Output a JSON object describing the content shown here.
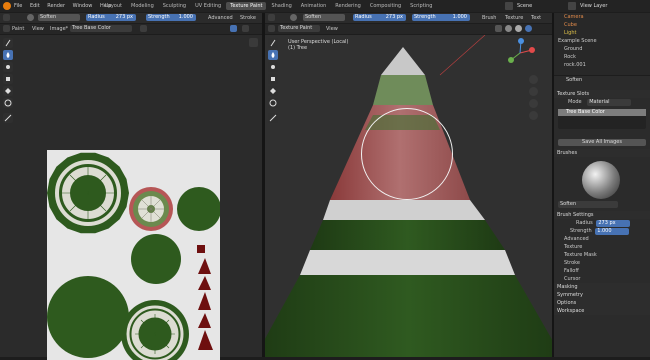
{
  "menu": [
    "File",
    "Edit",
    "Render",
    "Window",
    "Help"
  ],
  "workspaces": [
    {
      "label": "Layout",
      "active": false
    },
    {
      "label": "Modeling",
      "active": false
    },
    {
      "label": "Sculpting",
      "active": false
    },
    {
      "label": "UV Editing",
      "active": false
    },
    {
      "label": "Texture Paint",
      "active": true
    },
    {
      "label": "Shading",
      "active": false
    },
    {
      "label": "Animation",
      "active": false
    },
    {
      "label": "Rendering",
      "active": false
    },
    {
      "label": "Compositing",
      "active": false
    },
    {
      "label": "Scripting",
      "active": false
    }
  ],
  "scene": {
    "name": "Scene",
    "view_layer": "View Layer"
  },
  "image_editor": {
    "brush": "Soften",
    "radius_label": "Radius",
    "radius_value": "273 px",
    "strength_label": "Strength",
    "strength_value": "1.000",
    "advanced": "Advanced",
    "stroke": "Stroke",
    "mode": "Paint",
    "view": "View",
    "image": "Image*",
    "image_name": "Tree Base Color"
  },
  "viewport": {
    "brush": "Soften",
    "radius_label": "Radius",
    "radius_value": "273 px",
    "strength_label": "Strength",
    "strength_value": "1.000",
    "brush_menu": "Brush",
    "texture_menu": "Texture",
    "text_menu": "Text",
    "mode": "Texture Paint",
    "view": "View",
    "perspective": "User Perspective (Local)",
    "object": "(1) Tree"
  },
  "outliner": {
    "items": [
      "Camera",
      "Cube",
      "Light",
      "Example Scene",
      "Ground",
      "Rock",
      "rock.001"
    ]
  },
  "properties": {
    "object": "Soften",
    "texture_slots": "Texture Slots",
    "mode_label": "Mode",
    "mode_value": "Material",
    "slot": "Tree Base Color",
    "save_all": "Save All Images",
    "brushes": "Brushes",
    "brush_name": "Soften",
    "brush_settings": "Brush Settings",
    "radius_label": "Radius",
    "radius_value": "273 px",
    "strength_label": "Strength",
    "strength_value": "1.000",
    "subpanels": [
      "Advanced",
      "Texture",
      "Texture Mask",
      "Stroke",
      "Falloff",
      "Cursor"
    ],
    "sections": [
      "Masking",
      "Symmetry",
      "Options",
      "Workspace"
    ]
  },
  "colors": {
    "accent": "#4772b3",
    "tree_green": "#2e5a1e",
    "trunk_red": "#6e0f0f"
  }
}
